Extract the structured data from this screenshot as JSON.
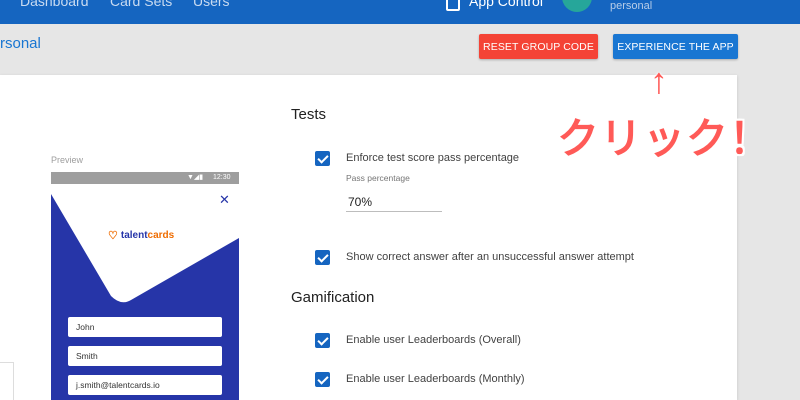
{
  "nav": {
    "items": [
      "Dashboard",
      "Card Sets",
      "Users"
    ],
    "app_control": "App Control",
    "user_sub": "personal"
  },
  "page": {
    "title": "rsonal"
  },
  "actions": {
    "reset_group_code": "RESET GROUP CODE",
    "experience_app": "EXPERIENCE THE APP"
  },
  "preview": {
    "label": "Preview",
    "status_icons": "▼◢▮",
    "time": "12:30",
    "close": "✕",
    "logo_heart": "♡",
    "logo_talent": "talent",
    "logo_cards": "cards",
    "fields": [
      "John",
      "Smith",
      "j.smith@talentcards.io"
    ]
  },
  "tests": {
    "title": "Tests",
    "enforce_label": "Enforce test score pass percentage",
    "pass_label": "Pass percentage",
    "pass_value": "70%",
    "show_correct_label": "Show correct answer after an unsuccessful answer attempt"
  },
  "gamification": {
    "title": "Gamification",
    "leaderboard_overall": "Enable user Leaderboards (Overall)",
    "leaderboard_monthly": "Enable user Leaderboards (Monthly)"
  },
  "annotation": {
    "arrow": "↑",
    "text": "クリック！"
  },
  "colors": {
    "topbar": "#1565c0",
    "primary": "#1976d2",
    "danger": "#f44336",
    "annotation": "#ff5a57",
    "phone_bg": "#2635a8"
  }
}
